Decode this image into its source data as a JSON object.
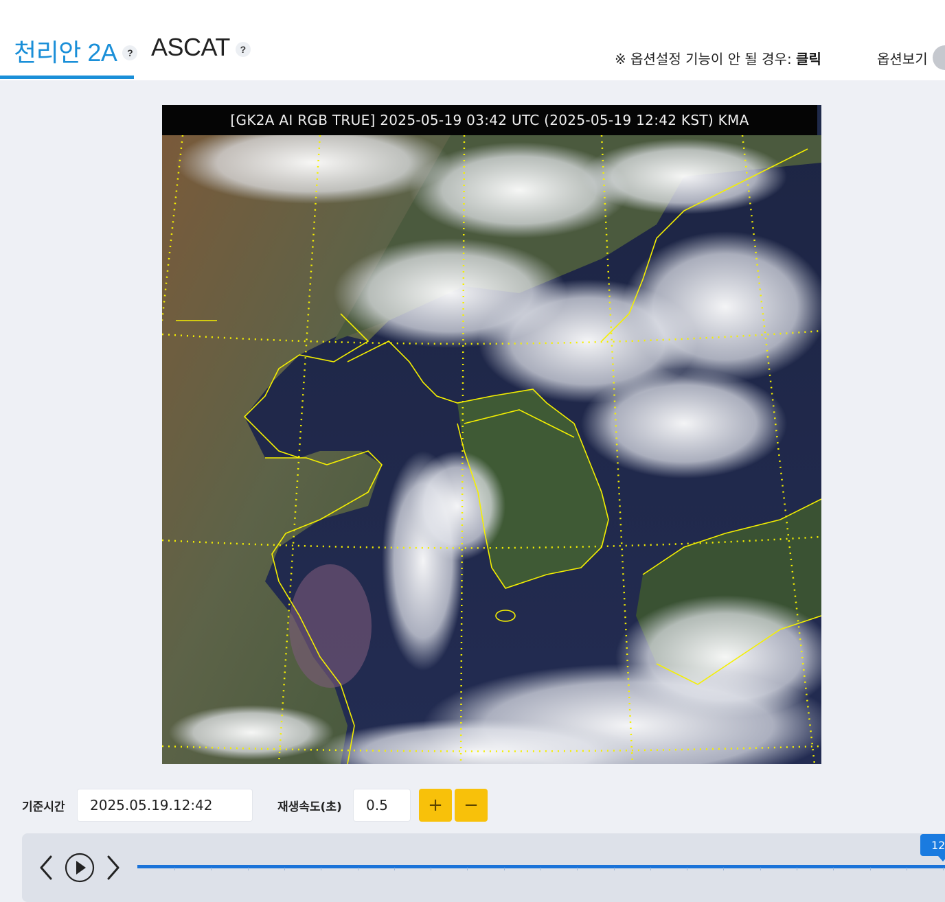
{
  "tabs": [
    {
      "label": "천리안 2A",
      "help": "?",
      "active": true
    },
    {
      "label": "ASCAT",
      "help": "?",
      "active": false
    }
  ],
  "header": {
    "option_note_prefix": "※ 옵션설정 기능이 안 될 경우: ",
    "option_note_link": "클릭",
    "option_view_label": "옵션보기"
  },
  "satellite": {
    "caption": "[GK2A AI RGB TRUE] 2025-05-19 03:42 UTC (2025-05-19 12:42 KST) KMA"
  },
  "controls": {
    "base_time_label": "기준시간",
    "base_time_value": "2025.05.19.12:42",
    "speed_label": "재생속도(초)",
    "speed_value": "0.5",
    "plus_symbol": "+",
    "minus_symbol": "−"
  },
  "timeline": {
    "current_time_label": "12:",
    "progress": 1.0
  },
  "colors": {
    "accent": "#1a8fd8",
    "track": "#1a73d9",
    "speed_button": "#f8c10a",
    "coastline": "#ffff00"
  },
  "icons": {
    "prev": "chevron-left-icon",
    "play": "play-circle-icon",
    "next": "chevron-right-icon"
  }
}
